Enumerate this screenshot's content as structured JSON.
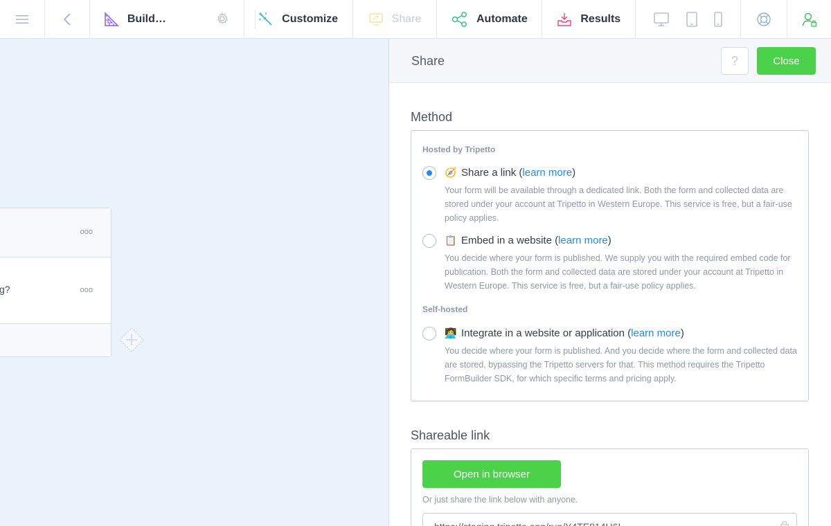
{
  "toolbar": {
    "menu_icon": "hamburger-icon",
    "back_icon": "chevron-left-icon",
    "build_label": "Build…",
    "customize_label": "Customize",
    "share_label": "Share",
    "automate_label": "Automate",
    "results_label": "Results",
    "devices": [
      "desktop-icon",
      "tablet-icon",
      "phone-icon"
    ],
    "help_icon": "lifebuoy-icon",
    "user_icon": "user-icon"
  },
  "canvas": {
    "card_dots": "ooo",
    "question_fragment": "g?"
  },
  "panel": {
    "title": "Share",
    "help_label": "?",
    "close_label": "Close",
    "method_title": "Method",
    "hosted_label": "Hosted by Tripetto",
    "self_hosted_label": "Self-hosted",
    "options": [
      {
        "emoji": "🧭",
        "title": "Share a link",
        "learn_more": "learn more",
        "checked": true,
        "description": "Your form will be available through a dedicated link. Both the form and collected data are stored under your account at Tripetto in Western Europe. This service is free, but a fair-use policy applies."
      },
      {
        "emoji": "📋",
        "title": "Embed in a website",
        "learn_more": "learn more",
        "checked": false,
        "description": "You decide where your form is published. We supply you with the required embed code for publication. Both the form and collected data are stored under your account at Tripetto in Western Europe. This service is free, but a fair-use policy applies."
      },
      {
        "emoji": "👩‍💻",
        "title": "Integrate in a website or application",
        "learn_more": "learn more",
        "checked": false,
        "description": "You decide where your form is published. And you decide where the form and collected data are stored, bypassing the Tripetto servers for that. This method requires the Tripetto FormBuilder SDK, for which specific terms and pricing apply."
      }
    ],
    "link_title": "Shareable link",
    "open_button": "Open in browser",
    "or_text": "Or just share the link below with anyone.",
    "url_value": "https://staging.tripetto.app/run/Y4TE814U6I"
  },
  "colors": {
    "accent_green": "#4cd24a",
    "link_blue": "#1c8cf0",
    "canvas_bg": "#eaf2fc"
  }
}
